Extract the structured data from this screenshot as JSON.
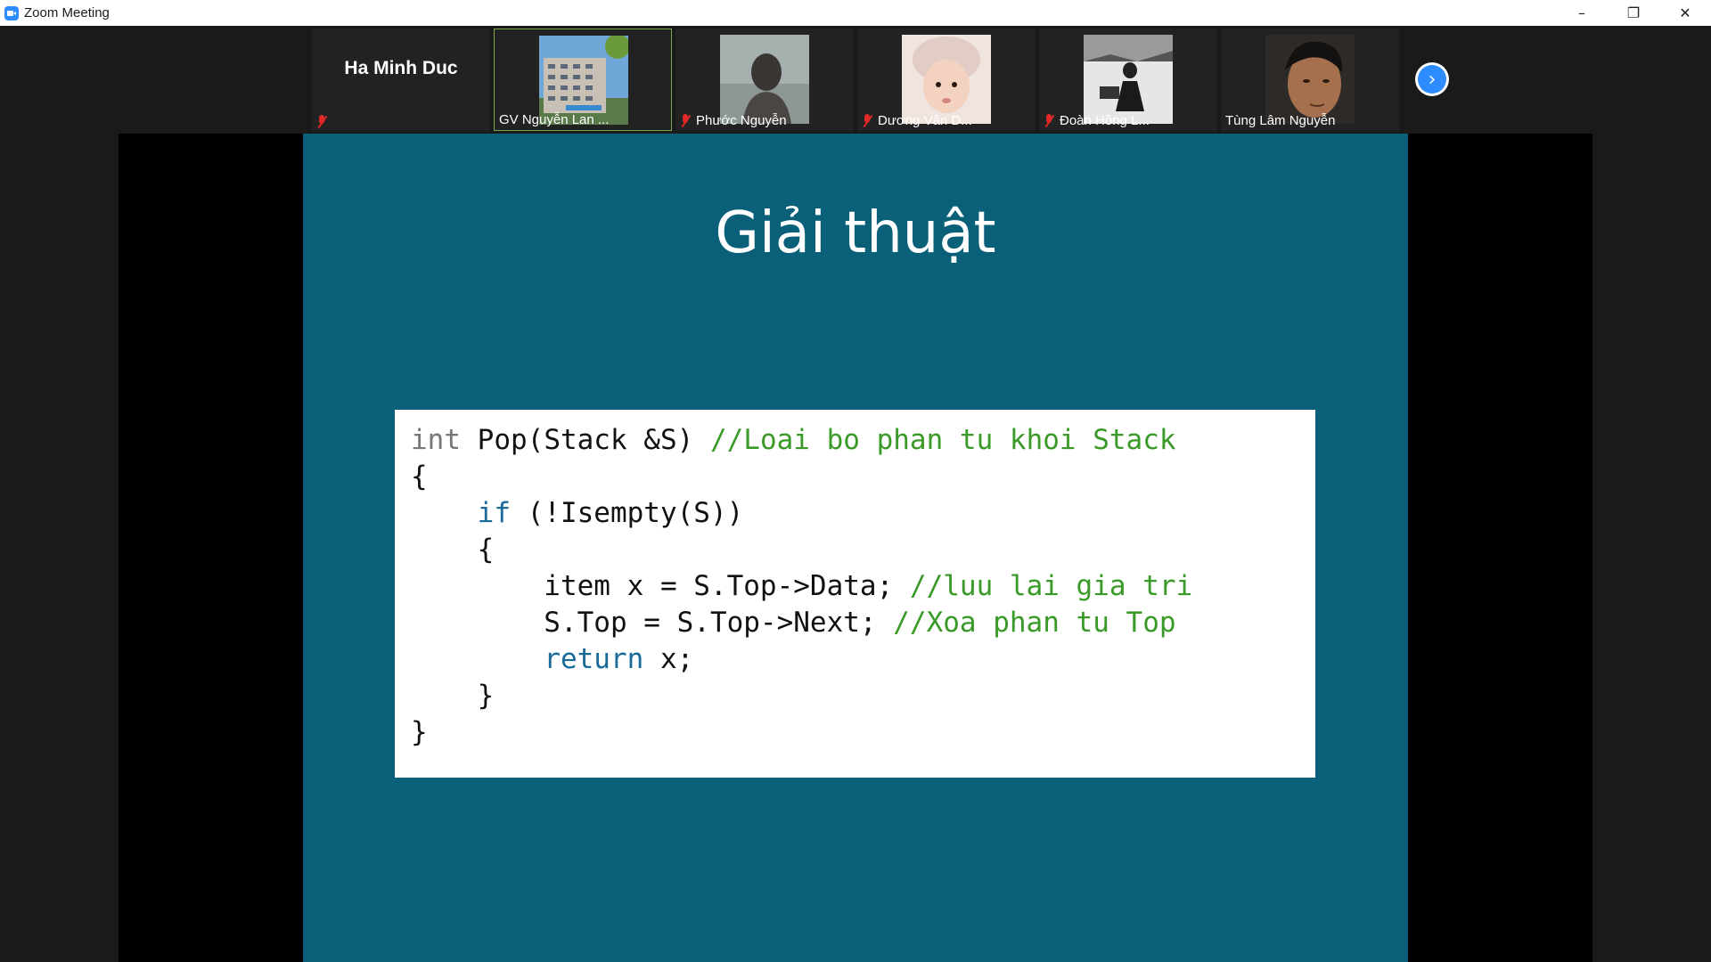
{
  "window": {
    "title": "Zoom Meeting",
    "controls": [
      "–",
      "❐",
      "✕"
    ]
  },
  "participants": [
    {
      "name": "Ha Minh Duc",
      "muted": true,
      "has_video": false
    },
    {
      "name": "GV Nguyễn Lan ...",
      "muted": false,
      "has_video": true,
      "active_speaker": true
    },
    {
      "name": "Phước Nguyễn",
      "muted": true,
      "has_video": true
    },
    {
      "name": "Dương Văn D...",
      "muted": true,
      "has_video": true
    },
    {
      "name": "Đoàn Hồng L...",
      "muted": true,
      "has_video": true
    },
    {
      "name": "Tùng Lâm Nguyễn",
      "muted": false,
      "has_video": true
    }
  ],
  "strip_next_icon": "chevron-right-icon",
  "slide": {
    "title": "Giải thuật",
    "code": {
      "l1_kw": "int",
      "l1_sig": " Pop(Stack &S) ",
      "l1_cmt": "//Loai bo phan tu khoi Stack",
      "l2": "{",
      "l3_indent": "    ",
      "l3_kw": "if",
      "l3_rest": " (!Isempty(S))",
      "l4": "    {",
      "l5_code": "        item x = S.Top->Data; ",
      "l5_cmt": "//luu lai gia tri",
      "l6_code": "        S.Top = S.Top->Next; ",
      "l6_cmt": "//Xoa phan tu Top",
      "l7_indent": "        ",
      "l7_kw": "return",
      "l7_rest": " x;",
      "l8": "    }",
      "l9": "}"
    }
  },
  "colors": {
    "slide_bg": "#0a6078",
    "comment": "#3a9a28",
    "keyword": "#1a6a9a",
    "active_border": "#7ba84a",
    "mute_red": "#e02828",
    "zoom_blue": "#2d8cff"
  }
}
